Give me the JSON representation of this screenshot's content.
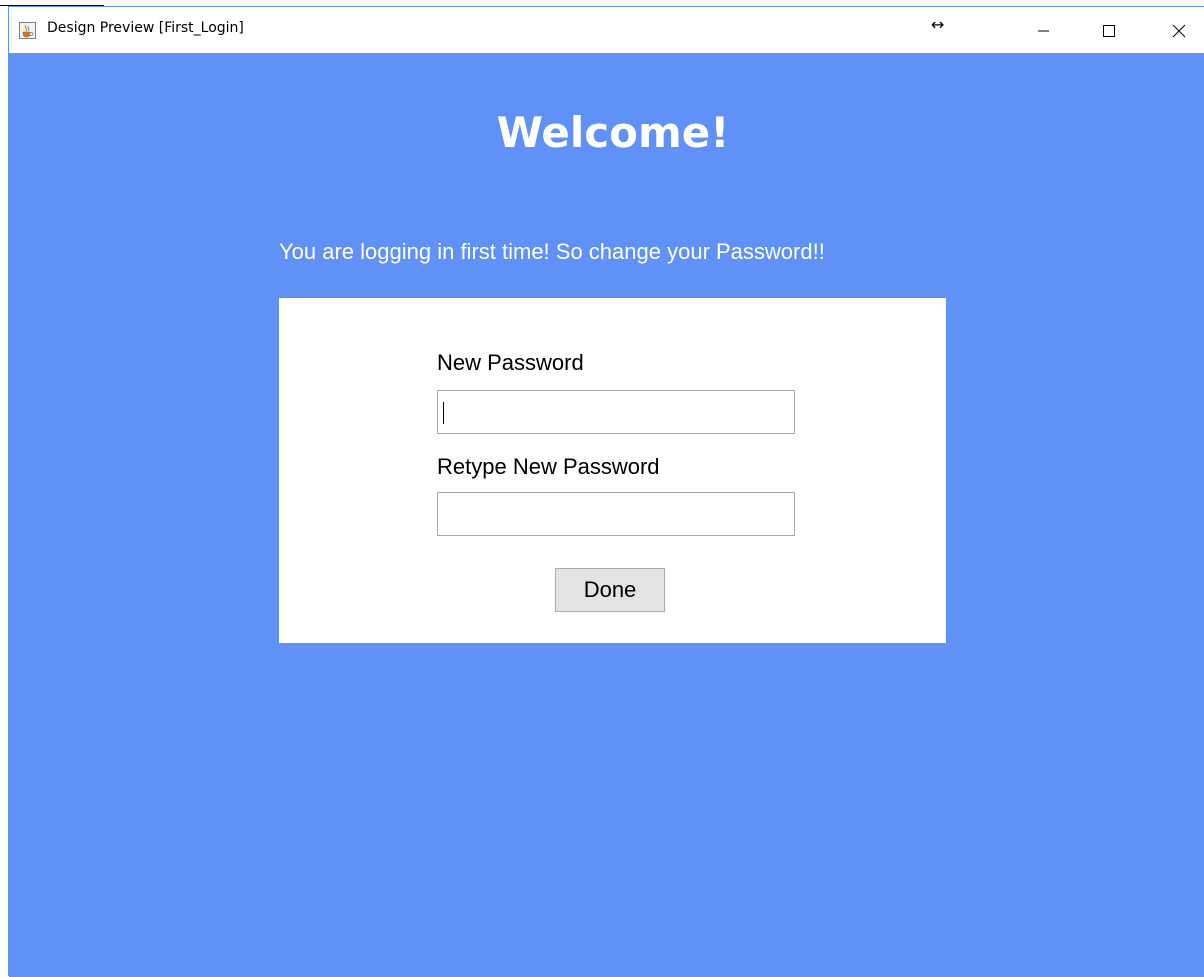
{
  "window": {
    "title": "Design Preview [First_Login]",
    "icons": {
      "app": "java-cup-icon",
      "resize": "horizontal-resize-icon",
      "minimize": "minimize-icon",
      "maximize": "maximize-icon",
      "close": "close-icon"
    },
    "resize_glyph": "↔"
  },
  "colors": {
    "background": "#5f91f7",
    "panel": "#ffffff",
    "text_light": "#ffffff",
    "text_dark": "#000000",
    "button": "#e3e3e3"
  },
  "main": {
    "heading": "Welcome!",
    "message": "You are logging in first time! So change your Password!!"
  },
  "form": {
    "new_password_label": "New Password",
    "new_password_value": "",
    "retype_password_label": "Retype New Password",
    "retype_password_value": "",
    "submit_label": "Done"
  }
}
